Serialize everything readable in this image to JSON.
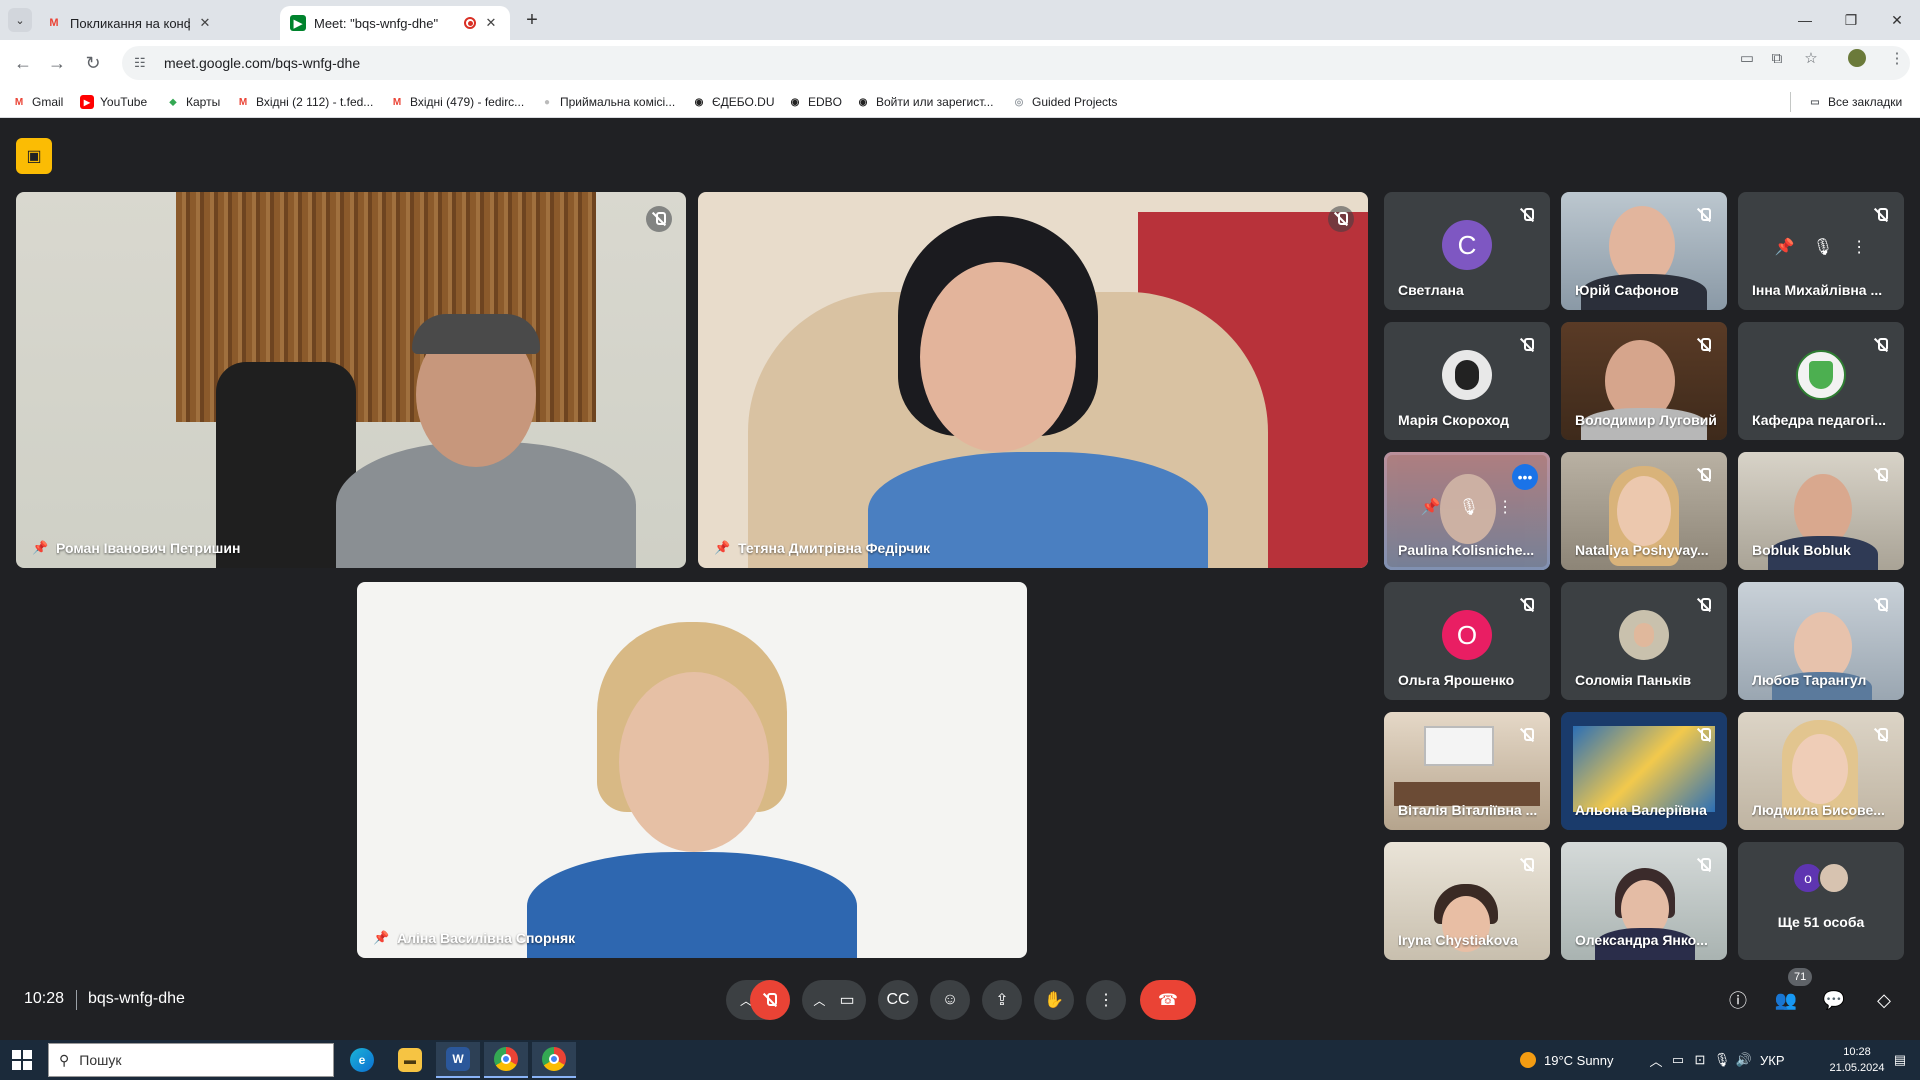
{
  "browser": {
    "tabs": [
      {
        "title": "Покликання на конференцію",
        "favicon": "gmail-icon",
        "active": false
      },
      {
        "title": "Meet: \"bqs-wnfg-dhe\"",
        "favicon": "meet-icon",
        "active": true
      }
    ],
    "url": "meet.google.com/bqs-wnfg-dhe",
    "bookmarks": [
      {
        "label": "Gmail",
        "icon": "gmail-icon"
      },
      {
        "label": "YouTube",
        "icon": "youtube-icon"
      },
      {
        "label": "Карты",
        "icon": "maps-icon"
      },
      {
        "label": "Вхідні (2 112) - t.fed...",
        "icon": "gmail-icon"
      },
      {
        "label": "Вхідні (479) - fedirc...",
        "icon": "gmail-icon"
      },
      {
        "label": "Приймальна комісі...",
        "icon": "globe-icon"
      },
      {
        "label": "ЄДЕБО.DU",
        "icon": "globe-icon"
      },
      {
        "label": "EDBO",
        "icon": "globe-icon"
      },
      {
        "label": "Войти или зарегист...",
        "icon": "globe-icon"
      },
      {
        "label": "Guided Projects",
        "icon": "globe-icon"
      }
    ],
    "all_bookmarks": "Все закладки"
  },
  "meet": {
    "main_tiles": [
      {
        "name": "Роман Іванович Петришин",
        "pinned": true
      },
      {
        "name": "Тетяна Дмитрівна Федірчик",
        "pinned": true
      },
      {
        "name": "Аліна Василівна Спорняк",
        "pinned": true
      }
    ],
    "side_tiles": [
      {
        "name": "Светлана",
        "avatar_letter": "С",
        "avatar_color": "#7e57c2"
      },
      {
        "name": "Юрій Сафонов"
      },
      {
        "name": "Інна Михайлівна ..."
      },
      {
        "name": "Марія Скороход"
      },
      {
        "name": "Володимир Луговий"
      },
      {
        "name": "Кафедра педагогі..."
      },
      {
        "name": "Paulina Kolisniche..."
      },
      {
        "name": "Nataliya Poshyvay..."
      },
      {
        "name": "Bobluk Bobluk"
      },
      {
        "name": "Ольга Ярошенко",
        "avatar_letter": "О",
        "avatar_color": "#e91e63"
      },
      {
        "name": "Соломія Паньків"
      },
      {
        "name": "Любов Тарангул"
      },
      {
        "name": "Віталія Віталіївна ..."
      },
      {
        "name": "Альона Валеріївна"
      },
      {
        "name": "Людмила Бисове..."
      },
      {
        "name": "Iryna Chystiakova"
      },
      {
        "name": "Олександра Янко..."
      }
    ],
    "others": {
      "label": "Ще 51 особа",
      "avatar_letter": "о"
    },
    "time": "10:28",
    "meeting_code": "bqs-wnfg-dhe",
    "participants_count": "71"
  },
  "taskbar": {
    "search_placeholder": "Пошук",
    "weather": "19°C  Sunny",
    "lang": "УКР",
    "time": "10:28",
    "date": "21.05.2024"
  },
  "colors": {
    "meet_bg": "#202124",
    "tile_bg": "#3c4043",
    "end_call": "#ea4335",
    "highlight": "#8ab4f8"
  }
}
